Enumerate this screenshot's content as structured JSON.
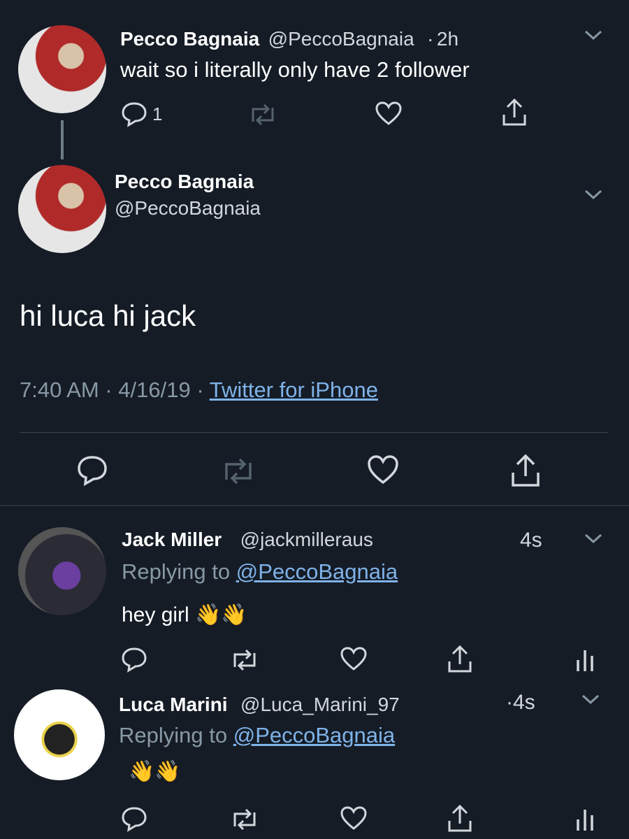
{
  "tweet1": {
    "name": "Pecco Bagnaia",
    "handle": "@PeccoBagnaia",
    "sep": "·",
    "time": "2h",
    "text": "wait so i literally only have 2 follower",
    "reply_count": "1"
  },
  "main_tweet": {
    "name": "Pecco Bagnaia",
    "handle": "@PeccoBagnaia",
    "text": "hi luca hi jack",
    "meta_time": "7:40 AM · 4/16/19 · ",
    "source": "Twitter for iPhone"
  },
  "reply1": {
    "name": "Jack Miller",
    "handle": "@jackmilleraus",
    "time": "4s",
    "replying_prefix": "Replying to ",
    "replying_to": "@PeccoBagnaia",
    "text": "hey girl 👋👋"
  },
  "reply2": {
    "name": "Luca Marini",
    "handle": "@Luca_Marini_97",
    "time": "·4s",
    "replying_prefix": "Replying to ",
    "replying_to": "@PeccoBagnaia",
    "text": "👋👋"
  },
  "colors": {
    "background": "#151c26",
    "secondary_text": "#8899a6",
    "link": "#7fb2e8"
  }
}
